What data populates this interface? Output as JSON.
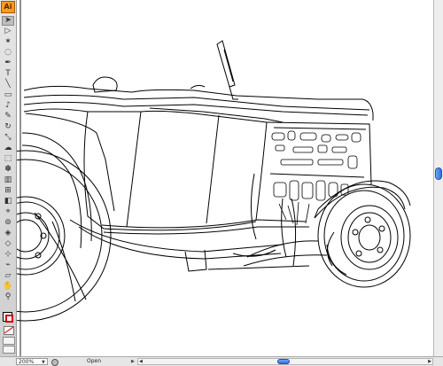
{
  "app": {
    "badge": "Ai"
  },
  "tools": {
    "items": [
      {
        "name": "selection-tool",
        "icon": "arrow-icon",
        "glyph": "➤",
        "active": true
      },
      {
        "name": "direct-selection-tool",
        "icon": "hollow-arrow-icon",
        "glyph": "▷",
        "active": false
      },
      {
        "name": "magic-wand-tool",
        "icon": "wand-icon",
        "glyph": "✶",
        "active": false
      },
      {
        "name": "lasso-tool",
        "icon": "lasso-icon",
        "glyph": "◌",
        "active": false
      },
      {
        "name": "pen-tool",
        "icon": "pen-icon",
        "glyph": "✒",
        "active": false
      },
      {
        "name": "type-tool",
        "icon": "type-icon",
        "glyph": "T",
        "active": false
      },
      {
        "name": "line-tool",
        "icon": "line-icon",
        "glyph": "╲",
        "active": false
      },
      {
        "name": "rectangle-tool",
        "icon": "rectangle-icon",
        "glyph": "▭",
        "active": false
      },
      {
        "name": "paintbrush-tool",
        "icon": "brush-icon",
        "glyph": "♪",
        "active": false
      },
      {
        "name": "pencil-tool",
        "icon": "pencil-icon",
        "glyph": "✎",
        "active": false
      },
      {
        "name": "rotate-tool",
        "icon": "rotate-icon",
        "glyph": "↻",
        "active": false
      },
      {
        "name": "scale-tool",
        "icon": "scale-icon",
        "glyph": "⤡",
        "active": false
      },
      {
        "name": "warp-tool",
        "icon": "warp-icon",
        "glyph": "☁",
        "active": false
      },
      {
        "name": "free-transform-tool",
        "icon": "transform-icon",
        "glyph": "⬚",
        "active": false
      },
      {
        "name": "symbol-sprayer-tool",
        "icon": "spray-icon",
        "glyph": "✽",
        "active": false
      },
      {
        "name": "column-graph-tool",
        "icon": "graph-icon",
        "glyph": "▥",
        "active": false
      },
      {
        "name": "mesh-tool",
        "icon": "mesh-icon",
        "glyph": "⊞",
        "active": false
      },
      {
        "name": "gradient-tool",
        "icon": "gradient-icon",
        "glyph": "◧",
        "active": false
      },
      {
        "name": "eyedropper-tool",
        "icon": "eyedropper-icon",
        "glyph": "⌖",
        "active": false
      },
      {
        "name": "blend-tool",
        "icon": "blend-icon",
        "glyph": "⊚",
        "active": false
      },
      {
        "name": "live-paint-tool",
        "icon": "paint-bucket-icon",
        "glyph": "◈",
        "active": false
      },
      {
        "name": "live-paint-selection-tool",
        "icon": "paint-select-icon",
        "glyph": "◇",
        "active": false
      },
      {
        "name": "crop-area-tool",
        "icon": "crop-icon",
        "glyph": "⊹",
        "active": false
      },
      {
        "name": "slice-tool",
        "icon": "slice-icon",
        "glyph": "⌁",
        "active": false
      },
      {
        "name": "eraser-tool",
        "icon": "eraser-icon",
        "glyph": "▱",
        "active": false
      },
      {
        "name": "hand-tool",
        "icon": "hand-icon",
        "glyph": "✋",
        "active": false
      },
      {
        "name": "zoom-tool",
        "icon": "magnifier-icon",
        "glyph": "⚲",
        "active": false
      }
    ],
    "colors": {
      "fill": "#ffffff",
      "stroke": "#d10000"
    }
  },
  "status": {
    "zoom": "200%",
    "state": "Open"
  }
}
